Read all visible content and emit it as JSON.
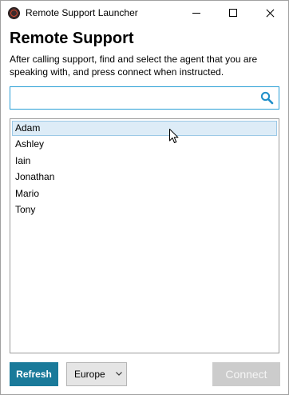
{
  "window": {
    "title": "Remote Support Launcher",
    "icon": "app-logo-icon",
    "controls": [
      "minimize-icon",
      "maximize-icon",
      "close-icon"
    ]
  },
  "main": {
    "heading": "Remote Support",
    "instructions": "After calling support, find and select the agent that you are speaking with, and press connect when instructed."
  },
  "search": {
    "value": "",
    "placeholder": "",
    "icon": "search-icon"
  },
  "agents": {
    "selected": "Adam",
    "items": [
      "Adam",
      "Ashley",
      "Iain",
      "Jonathan",
      "Mario",
      "Tony"
    ]
  },
  "footer": {
    "refresh_label": "Refresh",
    "region_value": "Europe",
    "connect_label": "Connect",
    "connect_enabled": false
  },
  "colors": {
    "accent": "#1a7a9a",
    "search_border": "#2a9fd6",
    "selection_bg": "#ddecf7",
    "disabled_button": "#cccccc"
  }
}
